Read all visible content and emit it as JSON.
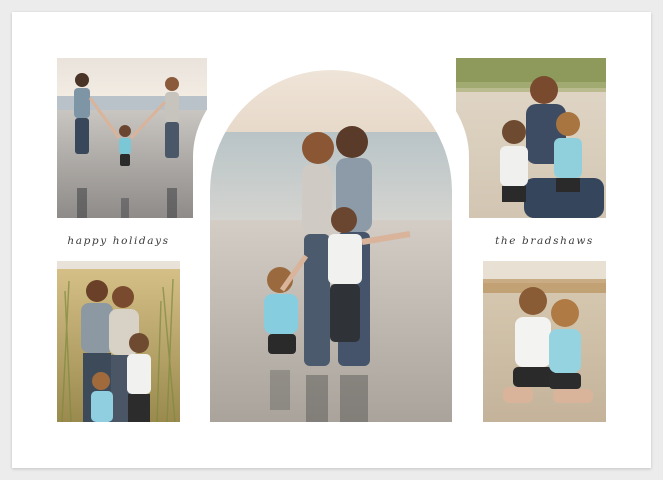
{
  "card": {
    "caption_left": "happy holidays",
    "caption_right": "the bradshaws"
  },
  "photos": [
    {
      "name": "beach-walk-photo",
      "subject": "two women walking a toddler along the shoreline"
    },
    {
      "name": "family-hug-arch-photo",
      "subject": "two women embracing two children on the beach"
    },
    {
      "name": "kids-with-mom-photo",
      "subject": "woman sitting with two children on sand"
    },
    {
      "name": "dune-grass-family-photo",
      "subject": "two women with two children in dune grass"
    },
    {
      "name": "siblings-sand-photo",
      "subject": "two children sitting on the sand"
    }
  ],
  "colors": {
    "card": "#ffffff",
    "background": "#ececec",
    "text": "#3a3a3a"
  }
}
